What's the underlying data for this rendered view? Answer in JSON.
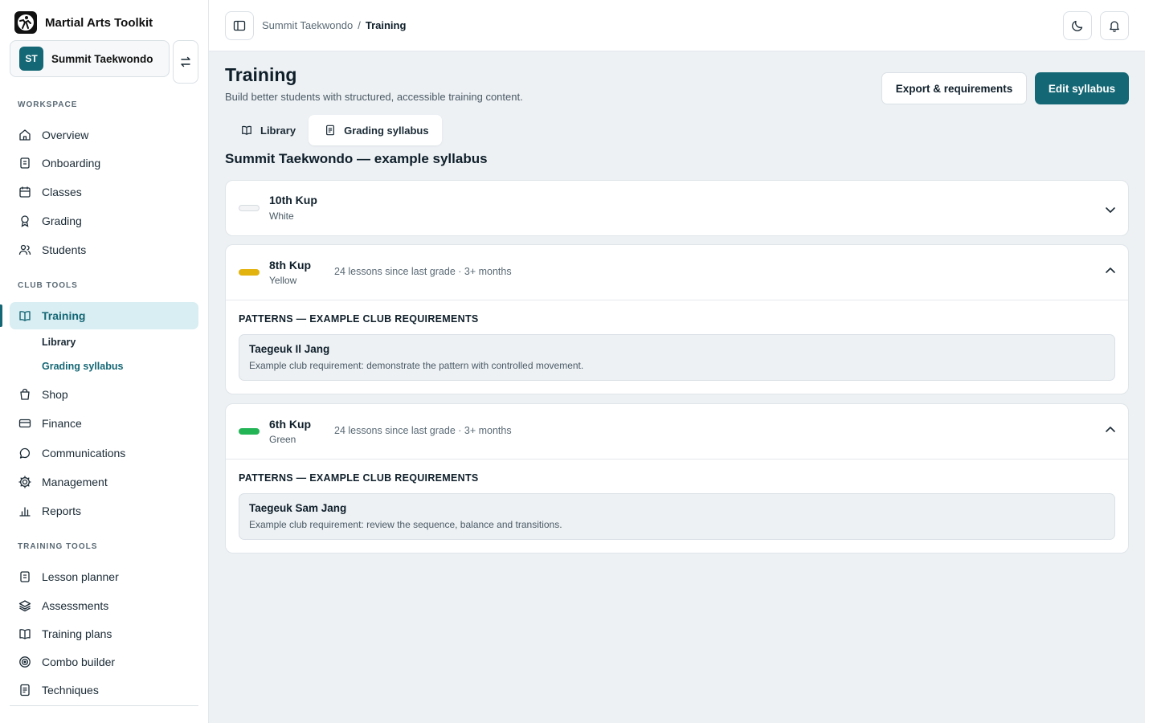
{
  "app": {
    "name": "Martial Arts Toolkit"
  },
  "club": {
    "initials": "ST",
    "name": "Summit Taekwondo"
  },
  "sidebar": {
    "workspace_label": "WORKSPACE",
    "workspace": [
      {
        "label": "Overview",
        "icon": "home-icon"
      },
      {
        "label": "Onboarding",
        "icon": "clipboard-icon"
      },
      {
        "label": "Classes",
        "icon": "calendar-icon"
      },
      {
        "label": "Grading",
        "icon": "award-icon"
      },
      {
        "label": "Students",
        "icon": "users-icon"
      }
    ],
    "club_tools_label": "CLUB TOOLS",
    "club_tools": [
      {
        "label": "Training",
        "icon": "book-open-icon",
        "active": true
      },
      {
        "label": "Shop",
        "icon": "shopping-bag-icon"
      },
      {
        "label": "Finance",
        "icon": "credit-card-icon"
      },
      {
        "label": "Communications",
        "icon": "message-circle-icon"
      },
      {
        "label": "Management",
        "icon": "gear-icon"
      },
      {
        "label": "Reports",
        "icon": "bar-chart-icon"
      }
    ],
    "training_sub": [
      {
        "label": "Library"
      },
      {
        "label": "Grading syllabus",
        "active": true
      }
    ],
    "training_tools_label": "TRAINING TOOLS",
    "training_tools": [
      {
        "label": "Lesson planner",
        "icon": "clipboard-icon"
      },
      {
        "label": "Assessments",
        "icon": "layers-icon"
      },
      {
        "label": "Training plans",
        "icon": "book-open-icon"
      },
      {
        "label": "Combo builder",
        "icon": "target-icon"
      },
      {
        "label": "Techniques",
        "icon": "document-icon"
      }
    ]
  },
  "topbar": {
    "breadcrumb": [
      "Summit Taekwondo",
      "/",
      "Training"
    ]
  },
  "page": {
    "title": "Training",
    "subtitle": "Build better students with structured, accessible training content.",
    "export_label": "Export & requirements",
    "edit_label": "Edit syllabus",
    "tabs": [
      {
        "label": "Library",
        "icon": "book-open-icon"
      },
      {
        "label": "Grading syllabus",
        "icon": "document-icon",
        "active": true
      }
    ],
    "syllabus_title": "Summit Taekwondo — example syllabus"
  },
  "grades": [
    {
      "rank": "10th Kup",
      "colour": "White",
      "belt_color": "#f2f4f5",
      "expanded": false
    },
    {
      "rank": "8th Kup",
      "colour": "Yellow",
      "belt_color": "#e2b20e",
      "meta": "24 lessons since last grade · 3+ months",
      "expanded": true,
      "section": "PATTERNS — EXAMPLE CLUB REQUIREMENTS",
      "requirement": {
        "name": "Taegeuk Il Jang",
        "desc": "Example club requirement: demonstrate the pattern with controlled movement."
      }
    },
    {
      "rank": "6th Kup",
      "colour": "Green",
      "belt_color": "#22b455",
      "meta": "24 lessons since last grade · 3+ months",
      "expanded": true,
      "section": "PATTERNS — EXAMPLE CLUB REQUIREMENTS",
      "requirement": {
        "name": "Taegeuk Sam Jang",
        "desc": "Example club requirement: review the sequence, balance and transitions."
      }
    }
  ],
  "colors": {
    "accent": "#146775",
    "accent_soft": "#d9eef2",
    "page_bg": "#edf1f4"
  }
}
